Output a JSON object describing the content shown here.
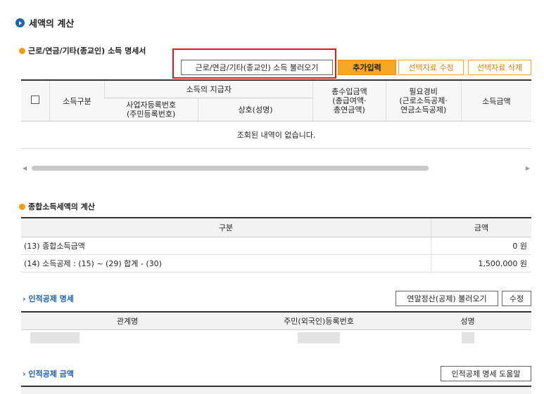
{
  "section_title": "세액의 계산",
  "income_section": {
    "title": "근로/연금/기타(종교인) 소득 명세서",
    "buttons": {
      "load": "근로/연금/기타(종교인) 소득 불러오기",
      "add": "추가입력",
      "edit": "선택자료 수정",
      "delete": "선택자료 삭제"
    },
    "headers": {
      "income_type": "소득구분",
      "payer": "소득의 지급자",
      "business_no": "사업자등록번호\n(주민등록번호)",
      "company_name": "상호(성명)",
      "total_income": "총수입금액\n(총급여액·\n총연금액)",
      "expenses": "필요경비\n(근로소득공제·\n연금소득공제)",
      "income_amount": "소득금액"
    },
    "empty_message": "조회된 내역이 없습니다."
  },
  "tax_section": {
    "title": "종합소득세액의 계산",
    "headers": {
      "category": "구분",
      "amount": "금액"
    },
    "rows": [
      {
        "label": "(13) 종합소득금액",
        "value": "0",
        "unit": "원"
      },
      {
        "label": "(14) 소득공제 : (15) ~ (29) 합계 - (30)",
        "value": "1,500,000",
        "unit": "원"
      }
    ]
  },
  "personal_deduction": {
    "title": "인적공제 명세",
    "buttons": {
      "load_yearend": "연말정산(공제) 불러오기",
      "edit": "수정"
    },
    "headers": {
      "relation": "관계명",
      "id_no": "주민(외국인)등록번호",
      "name": "성명"
    }
  },
  "deduction_amount": {
    "title": "인적공제 금액",
    "buttons": {
      "help": "인적공제 명세 도움말"
    }
  }
}
